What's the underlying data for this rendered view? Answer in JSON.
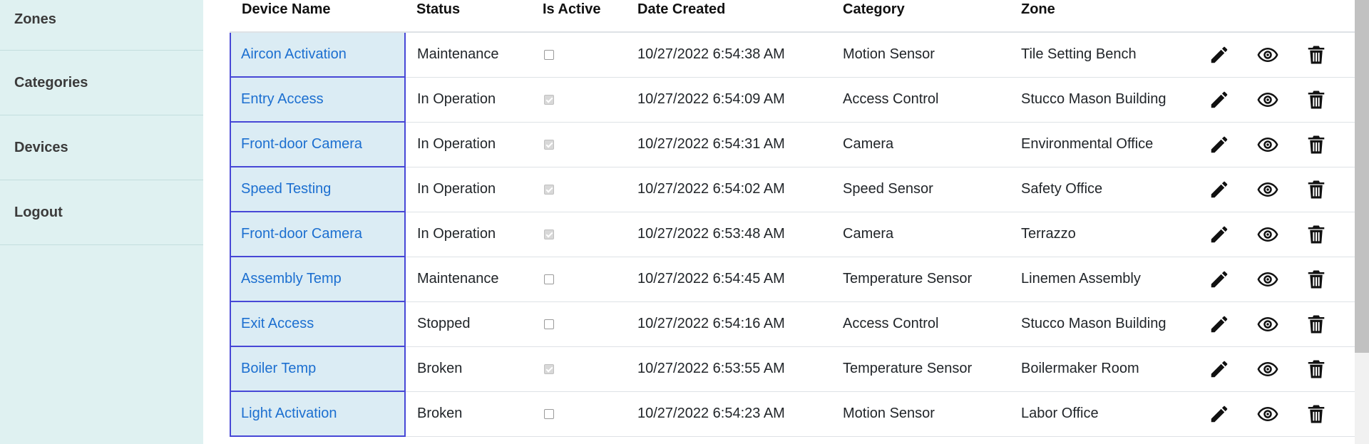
{
  "sidebar": {
    "items": [
      {
        "label": "Zones"
      },
      {
        "label": "Categories"
      },
      {
        "label": "Devices"
      },
      {
        "label": "Logout"
      }
    ]
  },
  "table": {
    "headers": {
      "device_name": "Device Name",
      "status": "Status",
      "is_active": "Is Active",
      "date_created": "Date Created",
      "category": "Category",
      "zone": "Zone"
    },
    "rows": [
      {
        "name": "Aircon Activation",
        "status": "Maintenance",
        "active": false,
        "date": "10/27/2022 6:54:38 AM",
        "category": "Motion Sensor",
        "zone": "Tile Setting Bench"
      },
      {
        "name": "Entry Access",
        "status": "In Operation",
        "active": true,
        "date": "10/27/2022 6:54:09 AM",
        "category": "Access Control",
        "zone": "Stucco Mason Building"
      },
      {
        "name": "Front-door Camera",
        "status": "In Operation",
        "active": true,
        "date": "10/27/2022 6:54:31 AM",
        "category": "Camera",
        "zone": "Environmental Office"
      },
      {
        "name": "Speed Testing",
        "status": "In Operation",
        "active": true,
        "date": "10/27/2022 6:54:02 AM",
        "category": "Speed Sensor",
        "zone": "Safety Office"
      },
      {
        "name": "Front-door Camera",
        "status": "In Operation",
        "active": true,
        "date": "10/27/2022 6:53:48 AM",
        "category": "Camera",
        "zone": "Terrazzo"
      },
      {
        "name": "Assembly Temp",
        "status": "Maintenance",
        "active": false,
        "date": "10/27/2022 6:54:45 AM",
        "category": "Temperature Sensor",
        "zone": "Linemen Assembly"
      },
      {
        "name": "Exit Access",
        "status": "Stopped",
        "active": false,
        "date": "10/27/2022 6:54:16 AM",
        "category": "Access Control",
        "zone": "Stucco Mason Building"
      },
      {
        "name": "Boiler Temp",
        "status": "Broken",
        "active": true,
        "date": "10/27/2022 6:53:55 AM",
        "category": "Temperature Sensor",
        "zone": "Boilermaker Room"
      },
      {
        "name": "Light Activation",
        "status": "Broken",
        "active": false,
        "date": "10/27/2022 6:54:23 AM",
        "category": "Motion Sensor",
        "zone": "Labor Office"
      }
    ],
    "row_actions": [
      "pencil-icon",
      "eye-icon",
      "trash-icon"
    ]
  },
  "colors": {
    "sidebar_bg": "#dff1f1",
    "link": "#1c6fd0",
    "selected_cell_bg": "#dbecf4",
    "selected_cell_border": "#4747d6"
  }
}
